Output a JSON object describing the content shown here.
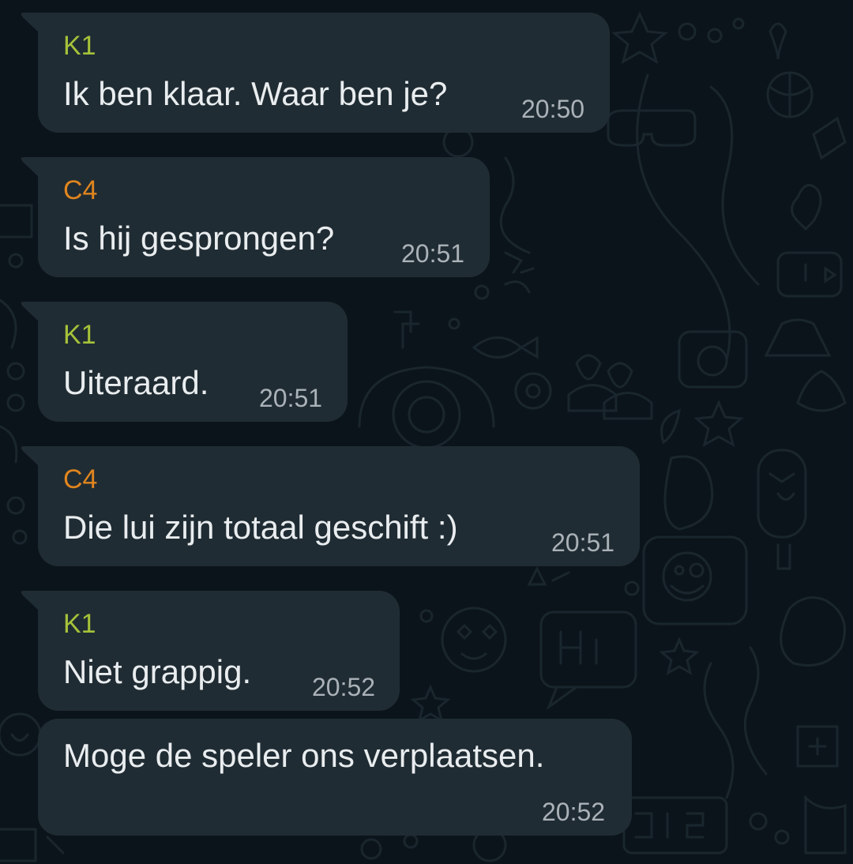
{
  "colors": {
    "background": "#0b141a",
    "bubble": "#202c33",
    "message_text": "#e9edef",
    "timestamp": "#aab2b8",
    "sender_k1": "#a5c23a",
    "sender_c4": "#e0851e"
  },
  "messages": [
    {
      "sender": "K1",
      "text": "Ik ben klaar. Waar ben je?",
      "time": "20:50"
    },
    {
      "sender": "C4",
      "text": "Is hij gesprongen?",
      "time": "20:51"
    },
    {
      "sender": "K1",
      "text": "Uiteraard.",
      "time": "20:51"
    },
    {
      "sender": "C4",
      "text": "Die lui zijn totaal geschift :)",
      "time": "20:51"
    },
    {
      "sender": "K1",
      "text": "Niet grappig.",
      "time": "20:52"
    },
    {
      "text": "Moge de speler ons verplaatsen.",
      "time": "20:52"
    }
  ]
}
